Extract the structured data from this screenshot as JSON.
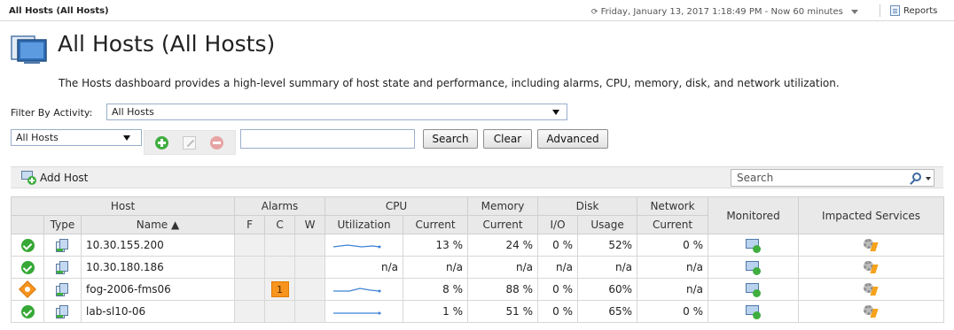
{
  "header": {
    "breadcrumb": "All Hosts (All Hosts)",
    "datetime": "Friday, January 13, 2017 1:18:49 PM - Now 60 minutes",
    "reports_label": "Reports"
  },
  "page": {
    "title": "All Hosts (All Hosts)",
    "description": "The Hosts dashboard provides a high-level summary of host state and performance, including alarms, CPU, memory, disk, and network utilization."
  },
  "filters": {
    "activity_label": "Filter By Activity:",
    "activity_value": "All Hosts",
    "scope_value": "All Hosts",
    "search_value": "",
    "search_button": "Search",
    "clear_button": "Clear",
    "advanced_button": "Advanced"
  },
  "toolbar": {
    "add_host_label": "Add Host",
    "grid_search_placeholder": "Search"
  },
  "table": {
    "group_headers": [
      "Host",
      "Alarms",
      "CPU",
      "Memory",
      "Disk",
      "Network",
      "Monitored",
      "Impacted Services"
    ],
    "sub_headers": [
      "Type",
      "Name ▲",
      "F",
      "C",
      "W",
      "Utilization",
      "Current",
      "Current",
      "I/O",
      "Usage",
      "Current"
    ],
    "rows": [
      {
        "status": "ok",
        "name": "10.30.155.200",
        "alarm_f": "",
        "alarm_c": "",
        "alarm_w": "",
        "cpu_spark": true,
        "cpu_current": "13 %",
        "mem_current": "24 %",
        "disk_io": "0 %",
        "disk_usage": "52%",
        "net_current": "0 %"
      },
      {
        "status": "ok",
        "name": "10.30.180.186",
        "alarm_f": "",
        "alarm_c": "",
        "alarm_w": "",
        "cpu_spark": false,
        "cpu_util_text": "n/a",
        "cpu_current": "n/a",
        "mem_current": "n/a",
        "disk_io": "n/a",
        "disk_usage": "n/a",
        "net_current": "n/a"
      },
      {
        "status": "warning",
        "name": "fog-2006-fms06",
        "alarm_f": "",
        "alarm_c": "1",
        "alarm_w": "",
        "cpu_spark": true,
        "cpu_current": "8 %",
        "mem_current": "88 %",
        "disk_io": "0 %",
        "disk_usage": "60%",
        "net_current": "n/a"
      },
      {
        "status": "ok",
        "name": "lab-sl10-06",
        "alarm_f": "",
        "alarm_c": "",
        "alarm_w": "",
        "cpu_spark": true,
        "cpu_current": "1 %",
        "mem_current": "51 %",
        "disk_io": "0 %",
        "disk_usage": "65%",
        "net_current": "0 %"
      }
    ]
  },
  "colors": {
    "ok": "#35a835",
    "warning": "#f7941d",
    "sparkline": "#3b82d6",
    "header_bg": "#e9e9e9"
  },
  "icons": [
    "host-monitor-icon",
    "reports-icon",
    "add-icon",
    "edit-icon",
    "remove-icon",
    "add-host-icon",
    "search-icon",
    "status-ok-icon",
    "status-warning-icon",
    "host-type-icon",
    "monitored-icon",
    "impacted-services-icon"
  ]
}
